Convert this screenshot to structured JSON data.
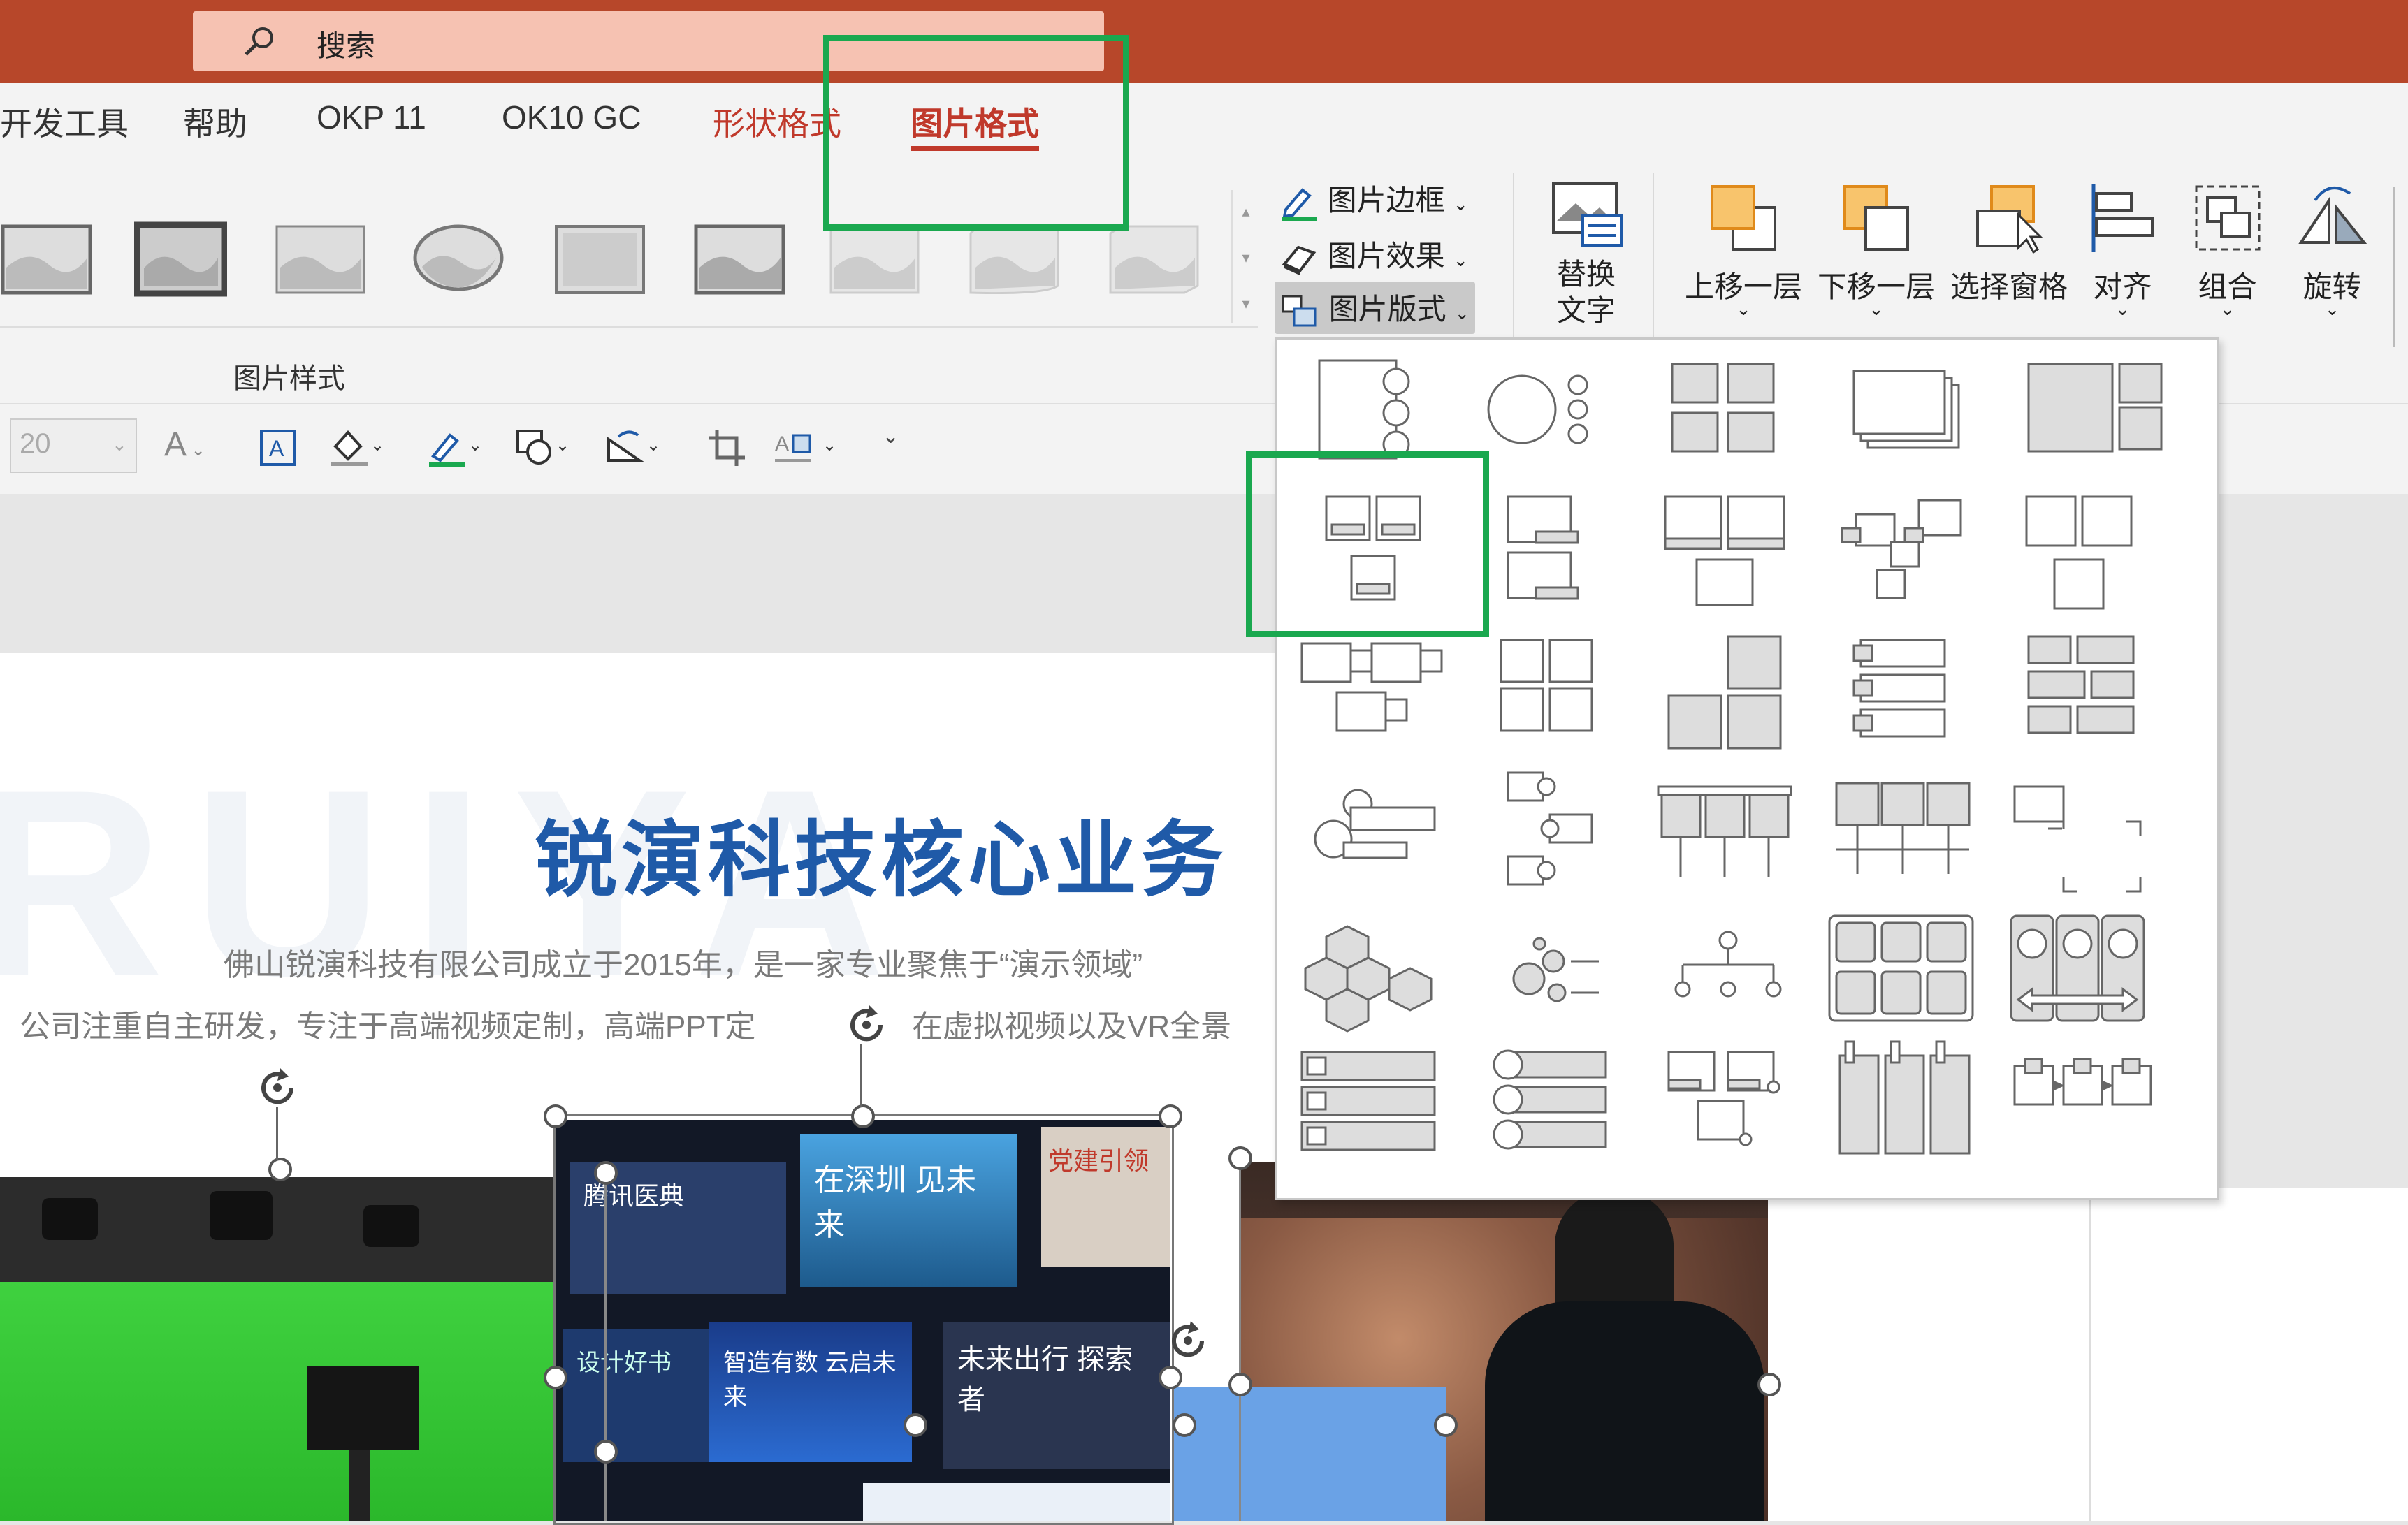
{
  "search": {
    "placeholder": "搜索"
  },
  "tabs": [
    {
      "label": "开发工具"
    },
    {
      "label": "帮助"
    },
    {
      "label": "OKP 11"
    },
    {
      "label": "OK10 GC"
    },
    {
      "label": "形状格式"
    },
    {
      "label": "图片格式"
    }
  ],
  "ribbon": {
    "group_label": "图片样式",
    "picture_border": "图片边框",
    "picture_effects": "图片效果",
    "picture_layout": "图片版式",
    "alt_text_line1": "替换",
    "alt_text_line2": "文字",
    "bring_forward": "上移一层",
    "send_backward": "下移一层",
    "selection_pane": "选择窗格",
    "align": "对齐",
    "group": "组合",
    "rotate": "旋转"
  },
  "font_size": {
    "value": "20"
  },
  "slide": {
    "watermark": "RUIYA",
    "title": "锐演科技核心业务",
    "body_line1": "佛山锐演科技有限公司成立于2015年，是一家专业聚焦于“演示领域”",
    "body_line2": "公司注重自主研发，专注于高端视频定制，高端PPT定",
    "body_line2b": "在虚拟视频以及VR全景",
    "photo2": {
      "card1": "腾讯医典",
      "card2": "在深圳 见未来",
      "card3": "党建引领",
      "card4": "设计好书",
      "card5": "智造有数 云启未来",
      "card6": "未来出行 探索者"
    }
  },
  "colors": {
    "title_bar": "#b7472a",
    "search_box": "#f6c2b2",
    "active_tab": "#c0392b",
    "highlight": "#1aa84f",
    "slide_title": "#1f5aa8"
  }
}
